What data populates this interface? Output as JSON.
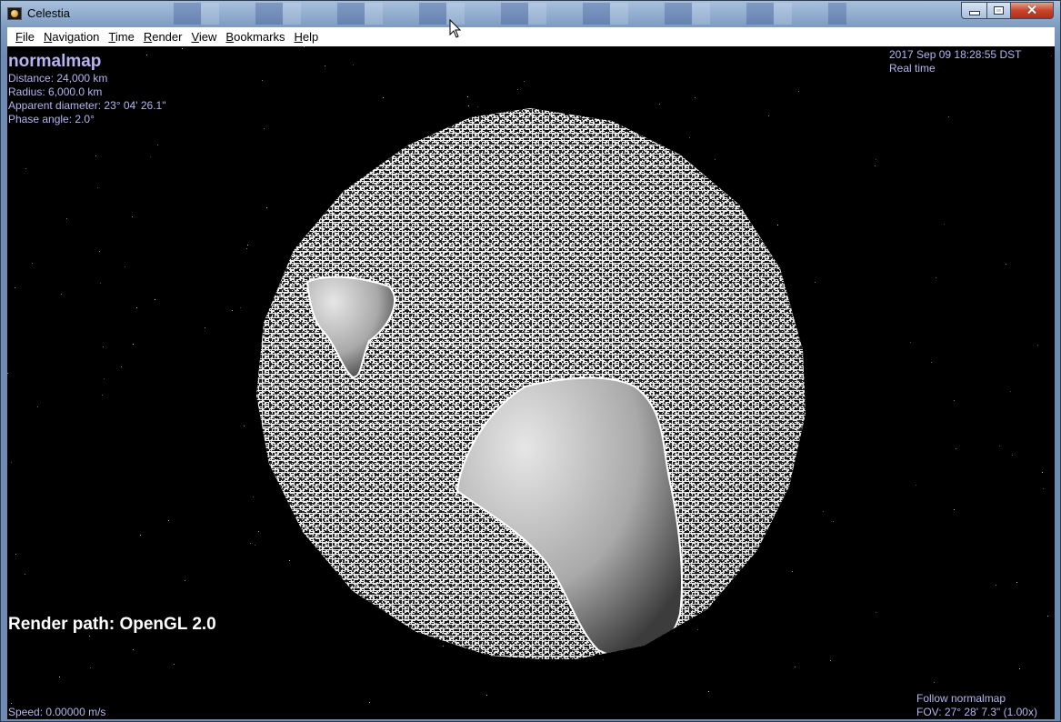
{
  "window": {
    "title": "Celestia",
    "icon": "celestia-app-icon",
    "controls": [
      "minimize-icon",
      "maximize-icon",
      "close-icon"
    ]
  },
  "menu": [
    {
      "label": "File",
      "key": "F",
      "rest": "ile"
    },
    {
      "label": "Navigation",
      "key": "N",
      "rest": "avigation"
    },
    {
      "label": "Time",
      "key": "T",
      "rest": "ime"
    },
    {
      "label": "Render",
      "key": "R",
      "rest": "ender"
    },
    {
      "label": "View",
      "key": "V",
      "rest": "iew"
    },
    {
      "label": "Bookmarks",
      "key": "B",
      "rest": "ookmarks"
    },
    {
      "label": "Help",
      "key": "H",
      "rest": "elp"
    }
  ],
  "hud": {
    "object_name": "normalmap",
    "distance": "Distance: 24,000 km",
    "radius": "Radius: 6,000.0 km",
    "apparent_diameter": "Apparent diameter: 23° 04' 26.1\"",
    "phase_angle": "Phase angle: 2.0°",
    "datetime": "2017 Sep 09 18:28:55 DST",
    "time_mode": "Real time",
    "render_path": "Render path: OpenGL 2.0",
    "speed": "Speed: 0.00000 m/s",
    "follow": "Follow normalmap",
    "fov": "FOV: 27° 28' 7.3\" (1.00x)"
  },
  "colors": {
    "hud_text": "#b7b4f1",
    "space": "#000000",
    "render_path_text": "#ffffff"
  }
}
